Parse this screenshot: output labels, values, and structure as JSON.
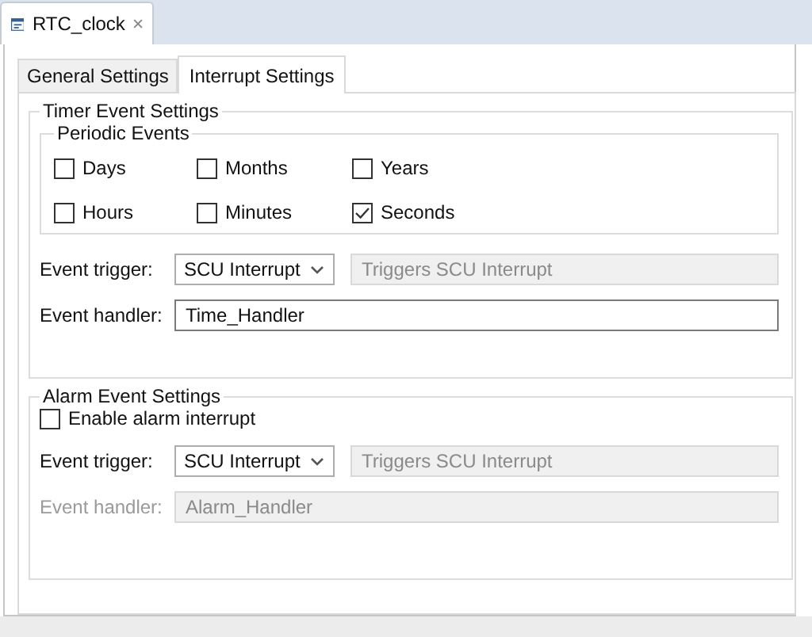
{
  "editor_tab": {
    "title": "RTC_clock",
    "selected": true
  },
  "tabs": [
    {
      "label": "General Settings",
      "selected": false
    },
    {
      "label": "Interrupt Settings",
      "selected": true
    }
  ],
  "timer": {
    "title": "Timer Event Settings",
    "periodic": {
      "title": "Periodic Events",
      "options": [
        {
          "label": "Days",
          "checked": false
        },
        {
          "label": "Months",
          "checked": false
        },
        {
          "label": "Years",
          "checked": false
        },
        {
          "label": "Hours",
          "checked": false
        },
        {
          "label": "Minutes",
          "checked": false
        },
        {
          "label": "Seconds",
          "checked": true
        }
      ]
    },
    "trigger": {
      "label": "Event trigger:",
      "value": "SCU Interrupt",
      "description": "Triggers SCU Interrupt",
      "description_disabled": true
    },
    "handler": {
      "label": "Event handler:",
      "value": "Time_Handler",
      "disabled": false
    }
  },
  "alarm": {
    "title": "Alarm Event Settings",
    "enable": {
      "label": "Enable alarm interrupt",
      "checked": false
    },
    "trigger": {
      "label": "Event trigger:",
      "value": "SCU Interrupt",
      "description": "Triggers SCU Interrupt",
      "description_disabled": true
    },
    "handler": {
      "label": "Event handler:",
      "value": "Alarm_Handler",
      "disabled": true
    }
  }
}
